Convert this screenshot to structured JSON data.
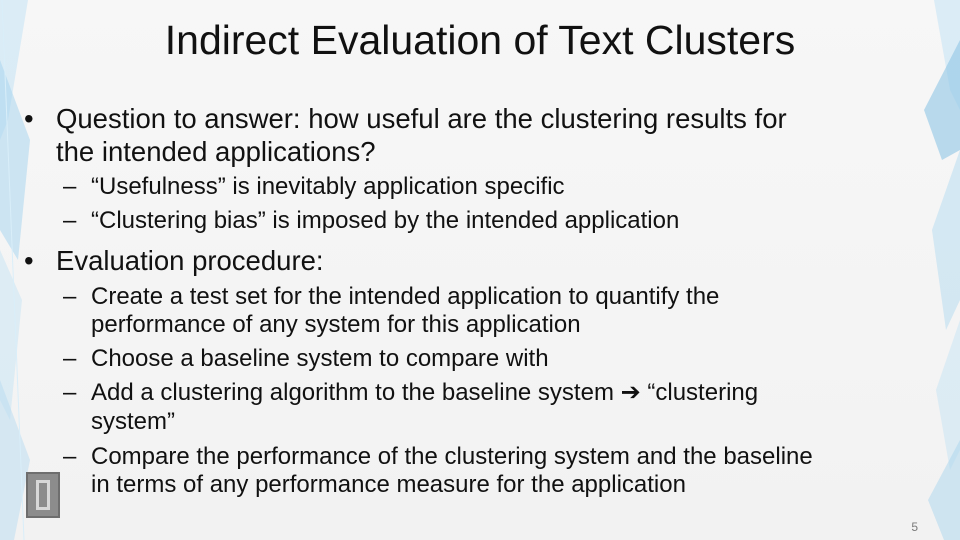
{
  "slide": {
    "title": "Indirect Evaluation of Text Clusters",
    "bullet_glyph": "•",
    "dash_glyph": "–",
    "items": [
      {
        "lines": [
          "Question to answer: how useful are the clustering results for",
          "the intended applications?"
        ],
        "sub": [
          {
            "lines": [
              "“Usefulness” is inevitably application specific"
            ]
          },
          {
            "lines": [
              "“Clustering bias” is imposed by the intended application"
            ]
          }
        ]
      },
      {
        "lines": [
          "Evaluation procedure:"
        ],
        "sub": [
          {
            "lines": [
              "Create a test set for the intended application to quantify the",
              "performance of any system for this application"
            ]
          },
          {
            "lines": [
              "Choose a baseline system to compare with"
            ]
          },
          {
            "lines": [
              "Add a clustering algorithm to the baseline system ➔ “clustering",
              "system”"
            ]
          },
          {
            "lines": [
              "Compare the performance of the clustering system and the baseline",
              "in terms of any performance measure for the application"
            ]
          }
        ]
      }
    ],
    "page_number": "5"
  },
  "colors": {
    "decor_blue": "#8fc7e6",
    "text": "#111111",
    "logo": "#8c8c8c"
  }
}
